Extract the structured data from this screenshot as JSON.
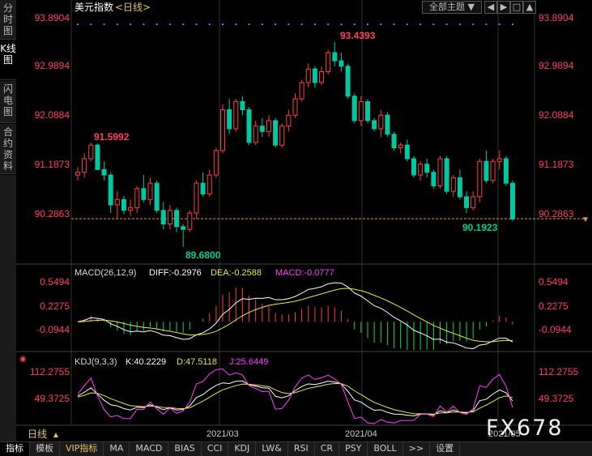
{
  "title": "美元指数",
  "period": "<日线>",
  "theme_button": "全部主题",
  "left_tabs": [
    "分时图",
    "K线图",
    "闪电图",
    "合约资料"
  ],
  "price_labels": [
    "93.8904",
    "92.9894",
    "92.0884",
    "91.1873",
    "90.2863"
  ],
  "high_label": "93.4393",
  "low_label": "89.6800",
  "local_high_label": "91.5992",
  "last_label": "90.1923",
  "macd": {
    "name": "MACD(26,12,9)",
    "diff": "DIFF:-0.2976",
    "dea": "DEA:-0.2588",
    "macd": "MACD:-0.0777",
    "labels": [
      "0.5494",
      "0.2275",
      "-0.0944"
    ]
  },
  "kdj": {
    "name": "KDJ(9,3,3)",
    "k": "K:40.2229",
    "d": "D:47.5118",
    "j": "J:25.6449",
    "labels": [
      "112.2755",
      "49.3725"
    ]
  },
  "date_labels": [
    "2021/03",
    "2021/04",
    "2021/05"
  ],
  "period_label": "日线",
  "watermark": "FX678",
  "toolbar": [
    "指标",
    "模板",
    "VIP指标",
    "MA",
    "MACD",
    "BIAS",
    "CCI",
    "KDJ",
    "LW&",
    "RSI",
    "CR",
    "PSY",
    "BOLL",
    ">>",
    "设置"
  ],
  "colors": {
    "up": "#ff4040",
    "down": "#00c8a0",
    "diff": "#ffffff",
    "dea": "#e8e84a",
    "macd": "#ff40ff",
    "price_label": "#ff4060"
  },
  "chart_data": {
    "type": "candlestick",
    "ohlc": [
      [
        91.0,
        91.15,
        90.9,
        91.05
      ],
      [
        91.05,
        91.4,
        90.95,
        91.3
      ],
      [
        91.3,
        91.6,
        91.25,
        91.55
      ],
      [
        91.55,
        91.58,
        91.1,
        91.1
      ],
      [
        91.1,
        91.25,
        90.9,
        91.0
      ],
      [
        91.0,
        91.05,
        90.3,
        90.45
      ],
      [
        90.45,
        90.7,
        90.2,
        90.55
      ],
      [
        90.55,
        90.62,
        90.28,
        90.35
      ],
      [
        90.35,
        90.55,
        90.25,
        90.4
      ],
      [
        90.4,
        90.8,
        90.3,
        90.75
      ],
      [
        90.75,
        91.0,
        90.5,
        90.55
      ],
      [
        90.55,
        90.95,
        90.45,
        90.85
      ],
      [
        90.85,
        90.9,
        90.3,
        90.35
      ],
      [
        90.35,
        90.5,
        90.0,
        90.1
      ],
      [
        90.1,
        90.45,
        90.0,
        90.35
      ],
      [
        90.35,
        90.4,
        89.95,
        90.05
      ],
      [
        90.05,
        90.1,
        89.68,
        90.0
      ],
      [
        90.0,
        90.35,
        89.95,
        90.3
      ],
      [
        90.3,
        90.9,
        90.2,
        90.85
      ],
      [
        90.85,
        91.05,
        90.6,
        90.65
      ],
      [
        90.65,
        91.1,
        90.6,
        91.0
      ],
      [
        91.0,
        91.5,
        90.95,
        91.45
      ],
      [
        91.45,
        92.3,
        91.4,
        92.2
      ],
      [
        92.2,
        92.4,
        91.75,
        91.85
      ],
      [
        91.85,
        92.4,
        91.8,
        92.35
      ],
      [
        92.35,
        92.45,
        92.1,
        92.2
      ],
      [
        92.2,
        92.25,
        91.55,
        91.6
      ],
      [
        91.6,
        92.0,
        91.55,
        91.9
      ],
      [
        91.9,
        92.05,
        91.7,
        91.8
      ],
      [
        91.8,
        92.1,
        91.7,
        92.0
      ],
      [
        92.0,
        92.05,
        91.5,
        91.55
      ],
      [
        91.55,
        91.95,
        91.5,
        91.9
      ],
      [
        91.9,
        92.2,
        91.8,
        92.1
      ],
      [
        92.1,
        92.5,
        92.05,
        92.4
      ],
      [
        92.4,
        92.75,
        92.35,
        92.7
      ],
      [
        92.7,
        93.05,
        92.6,
        92.95
      ],
      [
        92.95,
        93.0,
        92.6,
        92.7
      ],
      [
        92.7,
        93.0,
        92.65,
        92.9
      ],
      [
        92.9,
        93.3,
        92.85,
        93.25
      ],
      [
        93.25,
        93.44,
        93.0,
        93.1
      ],
      [
        93.1,
        93.25,
        92.9,
        93.0
      ],
      [
        93.0,
        93.05,
        92.4,
        92.45
      ],
      [
        92.45,
        92.5,
        91.95,
        92.0
      ],
      [
        92.0,
        92.45,
        91.9,
        92.35
      ],
      [
        92.35,
        92.4,
        91.95,
        92.0
      ],
      [
        92.0,
        92.05,
        91.8,
        91.85
      ],
      [
        91.85,
        92.2,
        91.7,
        92.1
      ],
      [
        92.1,
        92.15,
        91.7,
        91.75
      ],
      [
        91.75,
        91.8,
        91.45,
        91.5
      ],
      [
        91.5,
        91.6,
        91.4,
        91.55
      ],
      [
        91.55,
        91.65,
        91.25,
        91.3
      ],
      [
        91.3,
        91.35,
        90.95,
        91.0
      ],
      [
        91.0,
        91.25,
        90.9,
        91.2
      ],
      [
        91.2,
        91.3,
        90.95,
        91.05
      ],
      [
        91.05,
        91.1,
        90.75,
        90.8
      ],
      [
        90.8,
        91.35,
        90.75,
        91.3
      ],
      [
        91.3,
        91.35,
        90.65,
        90.7
      ],
      [
        90.7,
        91.0,
        90.6,
        90.95
      ],
      [
        90.95,
        91.1,
        90.55,
        90.6
      ],
      [
        90.6,
        90.7,
        90.3,
        90.4
      ],
      [
        90.4,
        90.7,
        90.35,
        90.6
      ],
      [
        90.6,
        91.3,
        90.5,
        91.25
      ],
      [
        91.25,
        91.45,
        90.85,
        90.9
      ],
      [
        90.9,
        91.3,
        90.85,
        91.25
      ],
      [
        91.25,
        91.45,
        91.1,
        91.3
      ],
      [
        91.3,
        91.35,
        90.8,
        90.85
      ],
      [
        90.85,
        90.9,
        90.15,
        90.19
      ]
    ]
  }
}
